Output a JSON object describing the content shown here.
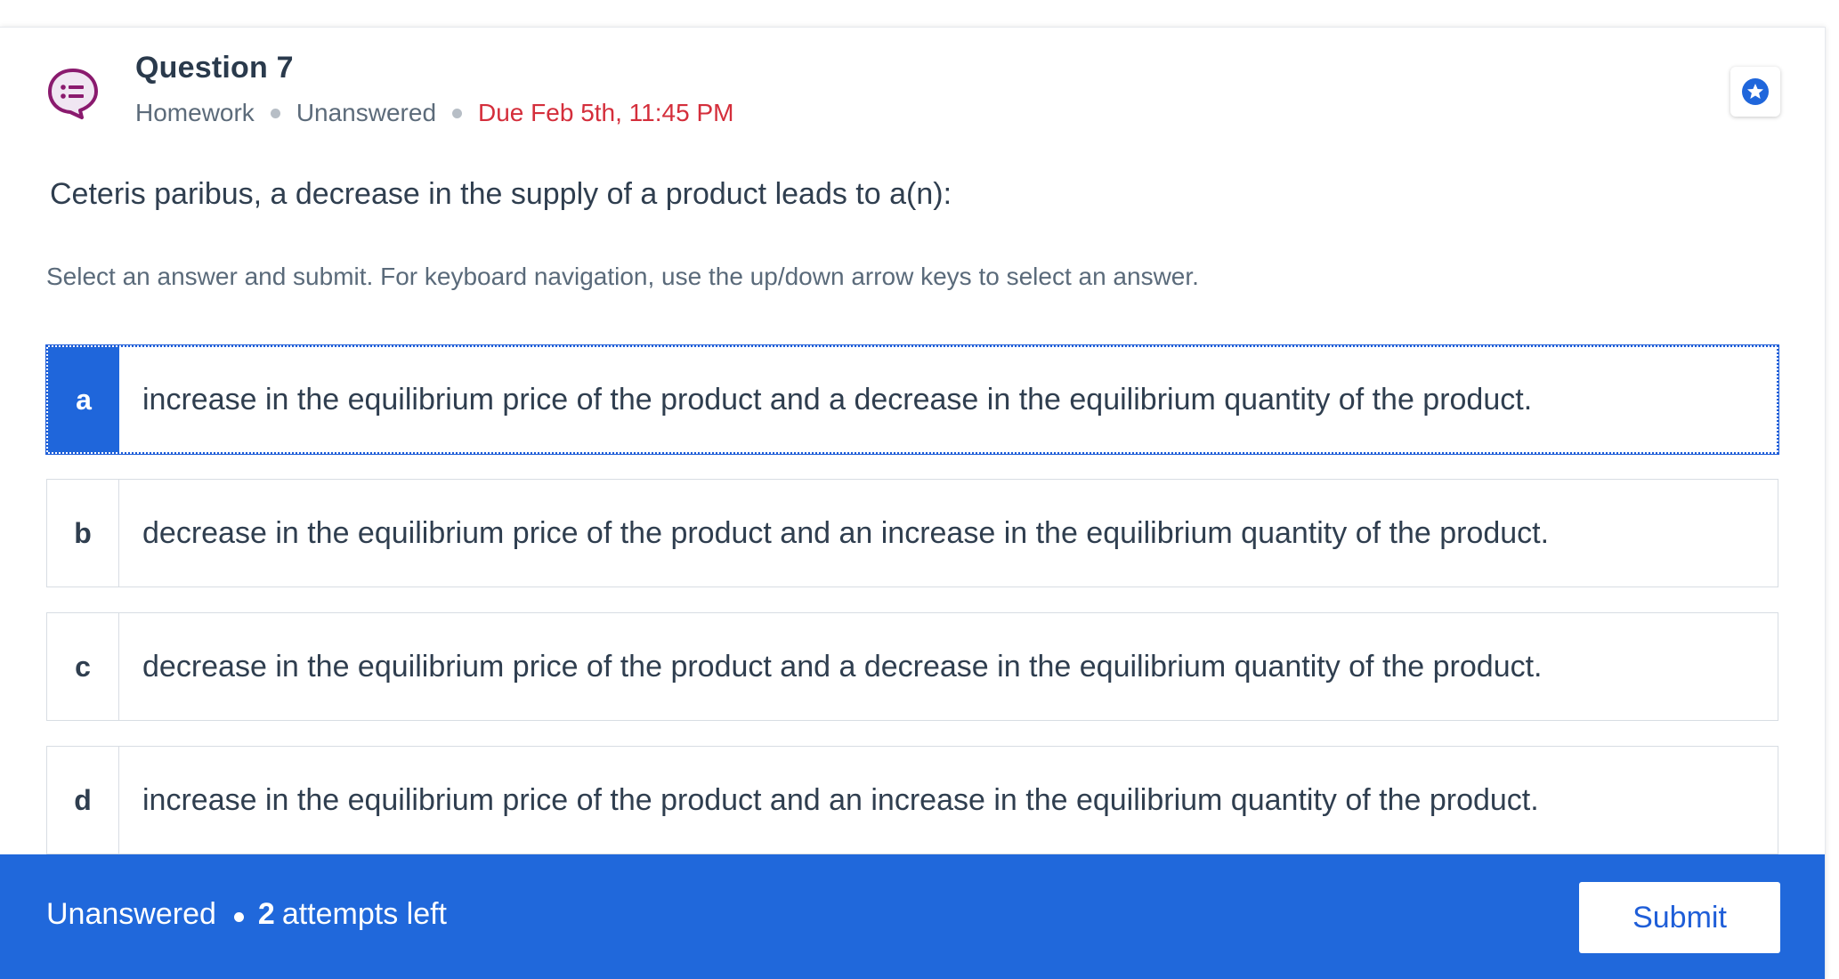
{
  "header": {
    "icon": "speech-bubble-list-icon",
    "title": "Question 7",
    "meta": {
      "type": "Homework",
      "status": "Unanswered",
      "due": "Due Feb 5th, 11:45 PM"
    },
    "bookmark_icon": "star-badge-icon"
  },
  "question": {
    "text": "Ceteris paribus, a decrease in the supply of a product leads to a(n):",
    "instructions": "Select an answer and submit. For keyboard navigation, use the up/down arrow keys to select an answer."
  },
  "answers": [
    {
      "letter": "a",
      "text": "increase in the equilibrium price of the product and a decrease in the equilibrium quantity of the product.",
      "selected": true
    },
    {
      "letter": "b",
      "text": "decrease in the equilibrium price of the product and an increase in the equilibrium quantity of the product.",
      "selected": false
    },
    {
      "letter": "c",
      "text": "decrease in the equilibrium price of the product and a decrease in the equilibrium quantity of the product.",
      "selected": false
    },
    {
      "letter": "d",
      "text": "increase in the equilibrium price of the product and an increase in the equilibrium quantity of the product.",
      "selected": false
    }
  ],
  "footer": {
    "status": "Unanswered",
    "attempts_count": "2",
    "attempts_suffix": "attempts left",
    "submit_label": "Submit"
  },
  "colors": {
    "accent": "#2068db",
    "due": "#d42e3b",
    "icon": "#8a1a6e"
  }
}
